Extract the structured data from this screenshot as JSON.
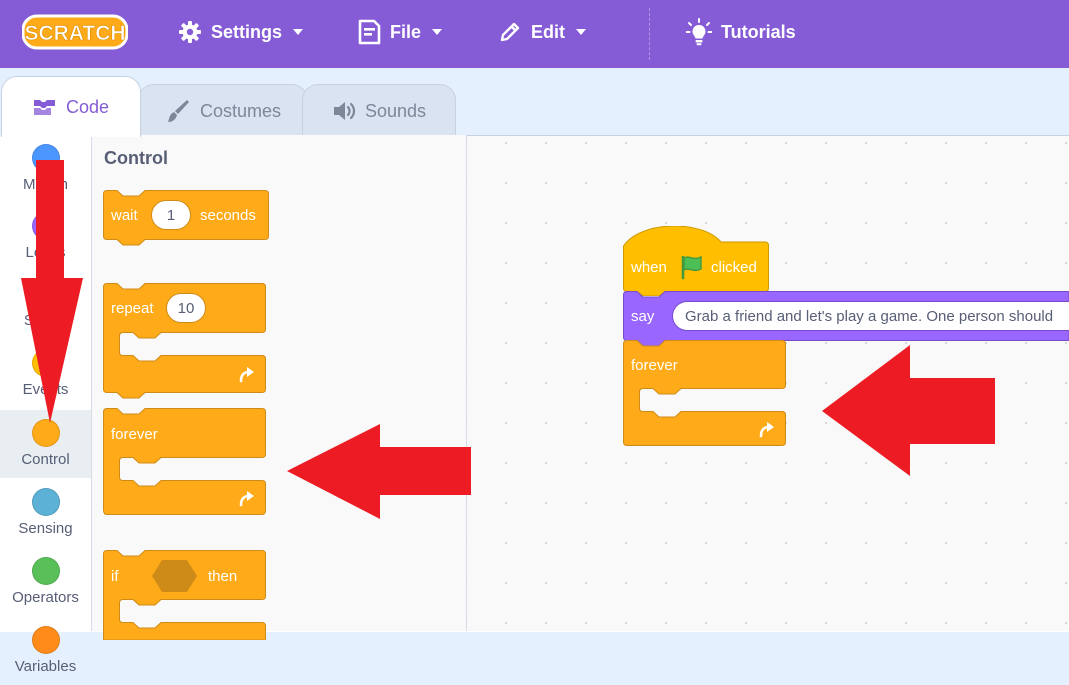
{
  "app": {
    "logo_text": "SCRATCH",
    "accent_color": "#855cd6"
  },
  "menubar": {
    "settings_label": "Settings",
    "file_label": "File",
    "edit_label": "Edit",
    "tutorials_label": "Tutorials"
  },
  "tabs": {
    "code_label": "Code",
    "costumes_label": "Costumes",
    "sounds_label": "Sounds"
  },
  "categories": [
    {
      "label": "Motion",
      "color": "#4c97ff"
    },
    {
      "label": "Looks",
      "color": "#9966ff"
    },
    {
      "label": "Sound",
      "color": "#cf63cf"
    },
    {
      "label": "Events",
      "color": "#ffbf00"
    },
    {
      "label": "Control",
      "color": "#ffab19",
      "selected": true
    },
    {
      "label": "Sensing",
      "color": "#5cb1d6"
    },
    {
      "label": "Operators",
      "color": "#59c059"
    },
    {
      "label": "Variables",
      "color": "#ff8c1a"
    }
  ],
  "palette": {
    "title": "Control",
    "wait_block": {
      "label": "wait",
      "value": "1",
      "unit": "seconds"
    },
    "repeat_block": {
      "label": "repeat",
      "value": "10"
    },
    "forever_block": {
      "label": "forever"
    },
    "if_block": {
      "label": "if",
      "then_label": "then"
    }
  },
  "script": {
    "hat_when": "when",
    "hat_clicked": "clicked",
    "say_label": "say",
    "say_text": "Grab a friend and let's play a game. One person should",
    "forever_label": "forever"
  },
  "annotation_color": "#ed1c24"
}
